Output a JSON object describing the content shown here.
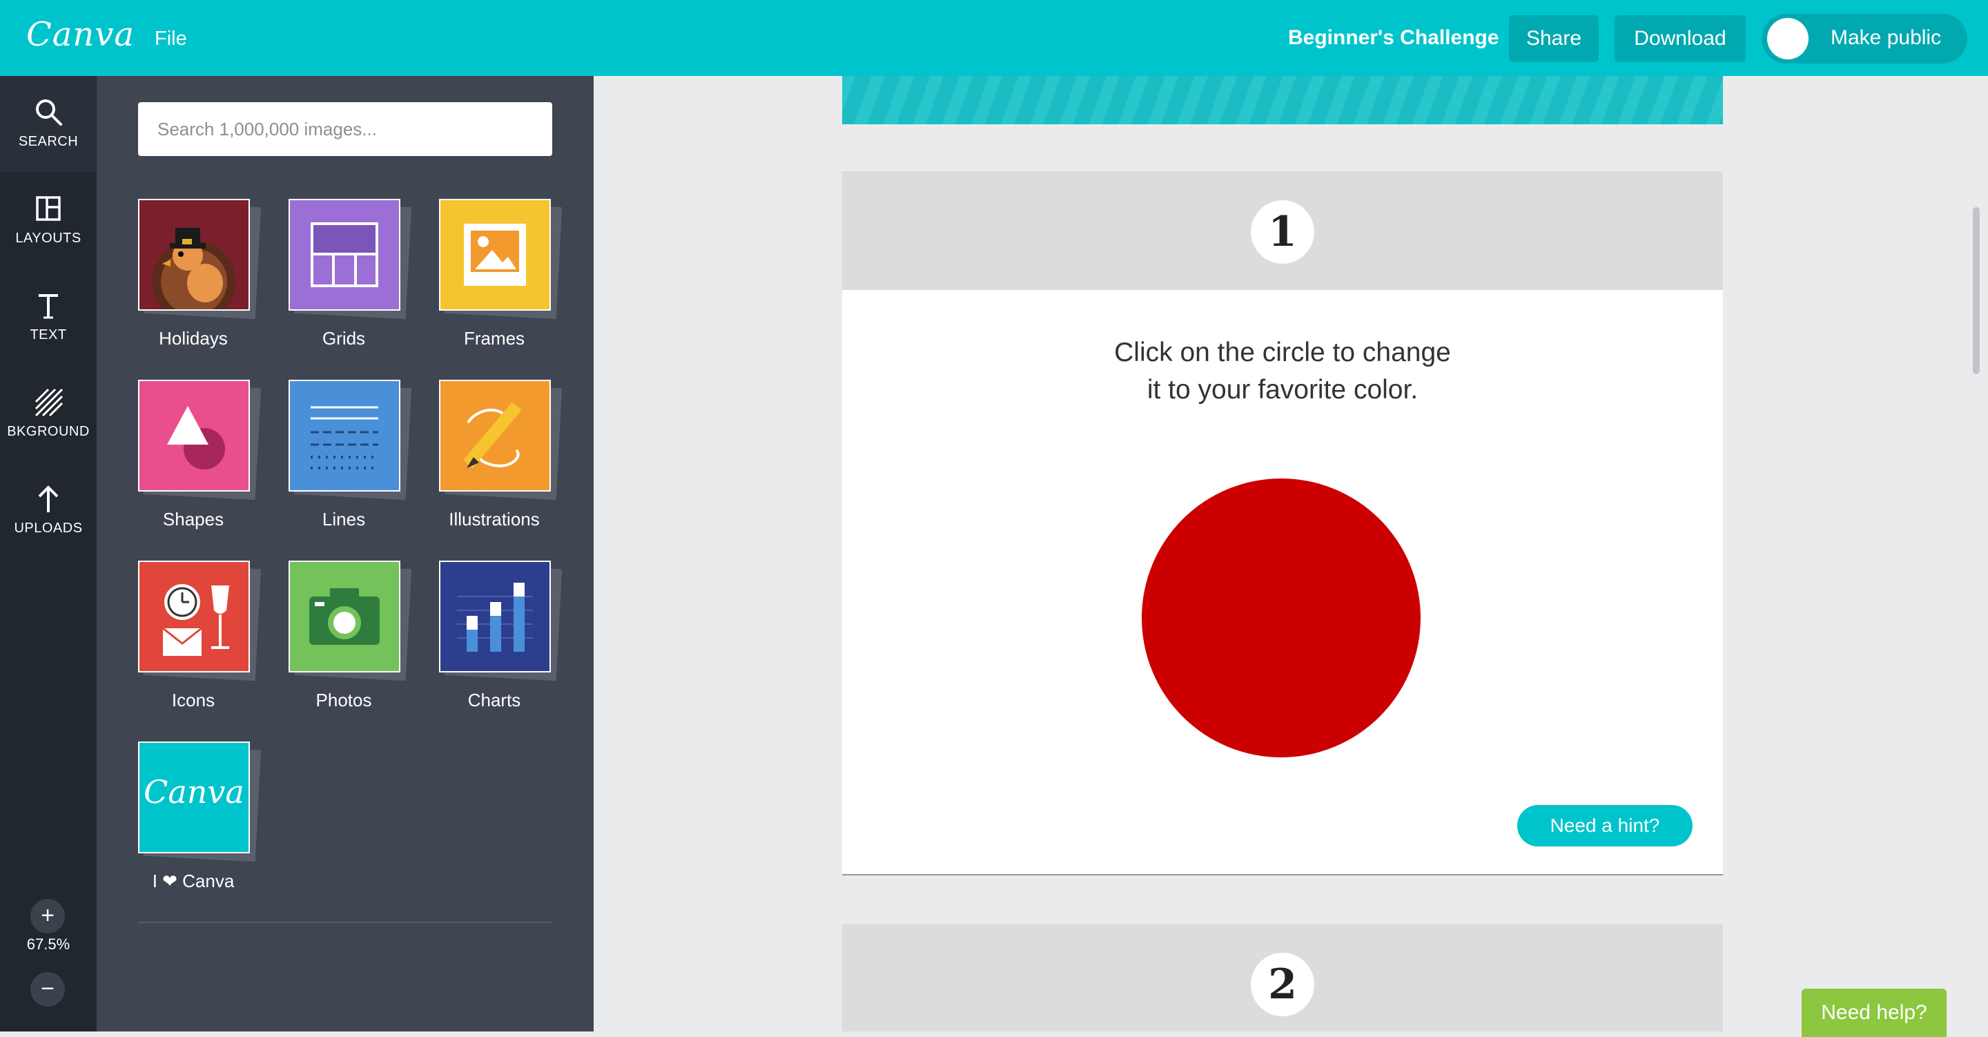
{
  "header": {
    "logo": "Canva",
    "file_menu": "File",
    "doc_title": "Beginner's Challenge",
    "share_label": "Share",
    "download_label": "Download",
    "make_public_label": "Make public"
  },
  "rail": {
    "items": [
      {
        "label": "SEARCH",
        "icon": "search-icon"
      },
      {
        "label": "LAYOUTS",
        "icon": "layouts-icon"
      },
      {
        "label": "TEXT",
        "icon": "text-icon"
      },
      {
        "label": "BKGROUND",
        "icon": "background-icon"
      },
      {
        "label": "UPLOADS",
        "icon": "upload-icon"
      }
    ],
    "zoom_in": "+",
    "zoom_out": "−",
    "zoom_level": "67.5%"
  },
  "panel": {
    "search_placeholder": "Search 1,000,000 images...",
    "tiles": [
      {
        "label": "Holidays",
        "color": "#7a1f2b"
      },
      {
        "label": "Grids",
        "color": "#9b6fd6"
      },
      {
        "label": "Frames",
        "color": "#f6c42e"
      },
      {
        "label": "Shapes",
        "color": "#e94f8c"
      },
      {
        "label": "Lines",
        "color": "#4a90d9"
      },
      {
        "label": "Illustrations",
        "color": "#f39a2f"
      },
      {
        "label": "Icons",
        "color": "#e0463a"
      },
      {
        "label": "Photos",
        "color": "#73c25a"
      },
      {
        "label": "Charts",
        "color": "#2d3e8f"
      },
      {
        "label": "I ❤ Canva",
        "color": "#00c4cc",
        "text": "Canva"
      }
    ]
  },
  "canvas": {
    "steps": [
      {
        "number": "1",
        "instruction_line1": "Click on the circle to change",
        "instruction_line2": "it to your favorite color.",
        "circle_color": "#cc0000",
        "hint_label": "Need a hint?"
      },
      {
        "number": "2"
      }
    ]
  },
  "help_label": "Need help?"
}
